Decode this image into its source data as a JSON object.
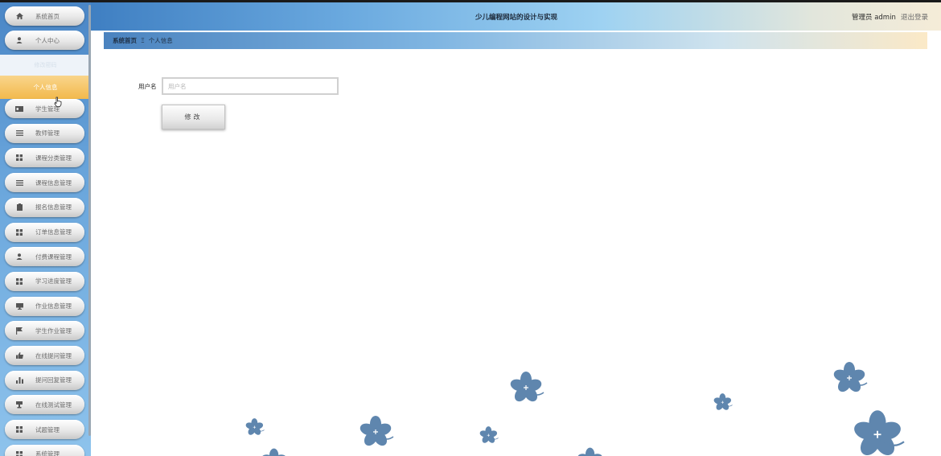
{
  "header": {
    "title": "少儿编程网站的设计与实现",
    "user": "管理员 admin",
    "logout": "退出登录"
  },
  "sidebar": {
    "top_items": [
      {
        "label": "系统首页",
        "icon": "home-icon"
      },
      {
        "label": "个人中心",
        "icon": "user-icon"
      }
    ],
    "submenu": {
      "collapsed_label": "修改密码",
      "active_label": "个人信息"
    },
    "items": [
      {
        "label": "学生管理",
        "icon": "id-card-icon"
      },
      {
        "label": "教师管理",
        "icon": "list-icon"
      },
      {
        "label": "课程分类管理",
        "icon": "grid-icon"
      },
      {
        "label": "课程信息管理",
        "icon": "list-icon"
      },
      {
        "label": "报名信息管理",
        "icon": "clipboard-icon"
      },
      {
        "label": "订单信息管理",
        "icon": "grid-icon"
      },
      {
        "label": "付费课程管理",
        "icon": "user-icon"
      },
      {
        "label": "学习进度管理",
        "icon": "grid-icon"
      },
      {
        "label": "作业信息管理",
        "icon": "monitor-icon"
      },
      {
        "label": "学生作业管理",
        "icon": "flag-icon"
      },
      {
        "label": "在线提问管理",
        "icon": "thumbs-up-icon"
      },
      {
        "label": "提问回复管理",
        "icon": "bar-chart-icon"
      },
      {
        "label": "在线测试管理",
        "icon": "cup-icon"
      },
      {
        "label": "试题管理",
        "icon": "grid-icon"
      },
      {
        "label": "系统管理",
        "icon": "grid-icon"
      }
    ]
  },
  "breadcrumb": {
    "home": "系统首页",
    "separator": "Ξ",
    "current": "个人信息"
  },
  "form": {
    "username_label": "用户名",
    "username_placeholder": "用户名",
    "username_value": "",
    "submit_label": "修改"
  },
  "colors": {
    "accent_blue": "#4a86c6",
    "active_orange": "#f2b94c",
    "flower": "#5f86ae"
  }
}
